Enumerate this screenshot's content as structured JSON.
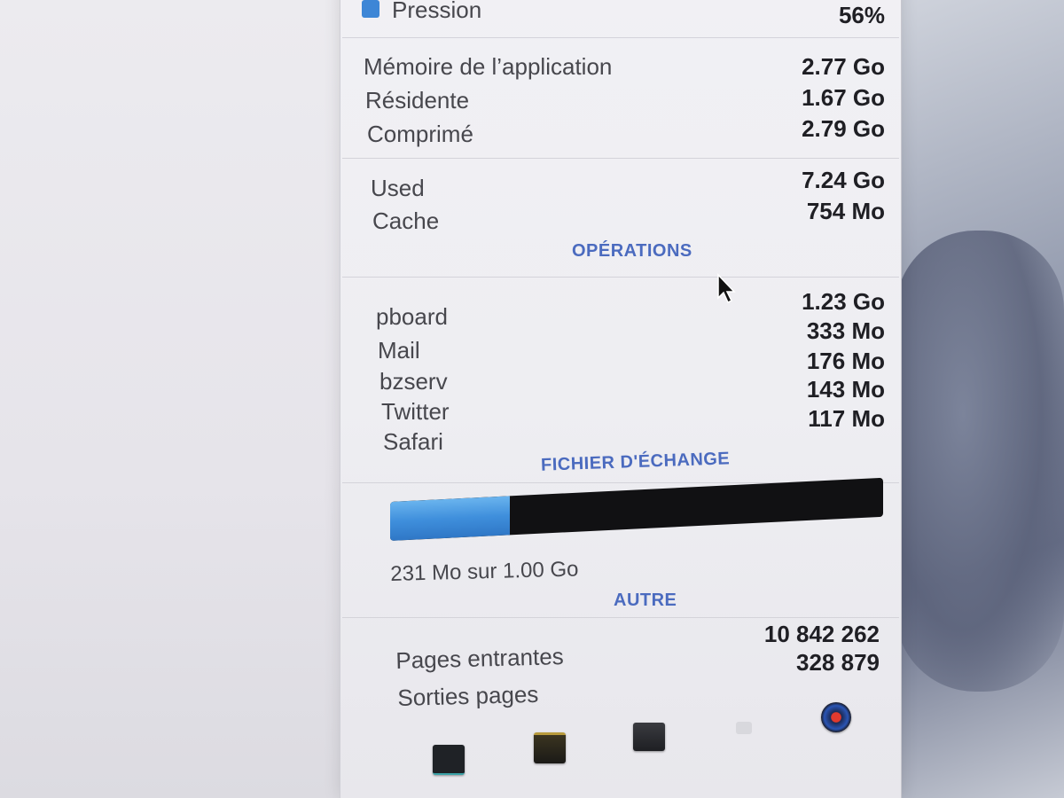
{
  "colors": {
    "section_title": "#4b6bbf",
    "pressure_indicator": "#3d86d6",
    "swap_fill": "#3f8fdc",
    "swap_track": "#111113"
  },
  "pressure": {
    "label": "Pression",
    "value": "56%"
  },
  "memory": [
    {
      "label": "Mémoire de l’application",
      "value": "2.77 Go"
    },
    {
      "label": "Résidente",
      "value": "1.67 Go"
    },
    {
      "label": "Comprimé",
      "value": "2.79 Go"
    }
  ],
  "usage": [
    {
      "label": "Used",
      "value": "7.24 Go"
    },
    {
      "label": "Cache",
      "value": "754 Mo"
    }
  ],
  "operations": {
    "title": "OPÉRATIONS",
    "items": [
      {
        "label": "pboard",
        "value": "1.23 Go"
      },
      {
        "label": "Mail",
        "value": "333 Mo"
      },
      {
        "label": "bzserv",
        "value": "176 Mo"
      },
      {
        "label": "Twitter",
        "value": "143 Mo"
      },
      {
        "label": "Safari",
        "value": "117 Mo"
      }
    ]
  },
  "swap": {
    "title": "FICHIER D'ÉCHANGE",
    "fill_fraction": 0.243,
    "caption": "231 Mo sur 1.00 Go"
  },
  "other": {
    "title": "AUTRE",
    "items": [
      {
        "label": "Pages entrantes",
        "value": "10 842 262"
      },
      {
        "label": "Sorties pages",
        "value": "328 879"
      }
    ]
  },
  "dock": {
    "icons": [
      "console-icon",
      "activity-log-icon",
      "terminal-icon",
      "hidden-app-icon",
      "activity-monitor-icon"
    ]
  }
}
